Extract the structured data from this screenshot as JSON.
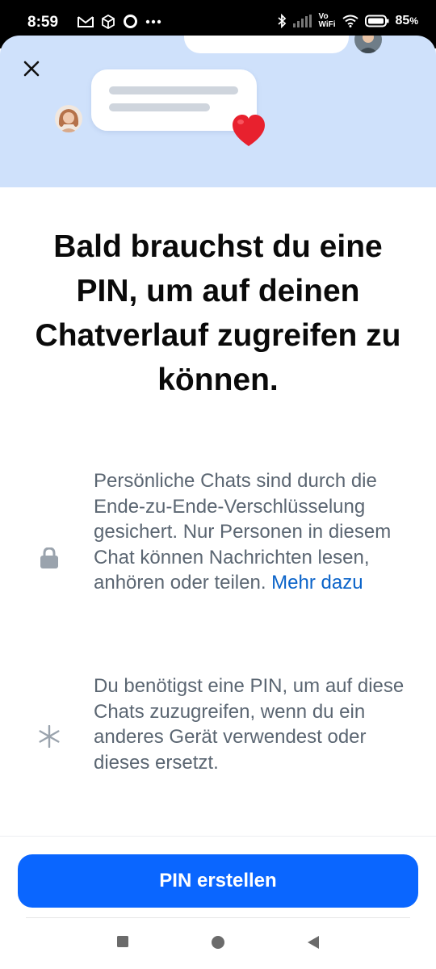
{
  "status_bar": {
    "time": "8:59",
    "left_icons": [
      "gmail-icon",
      "cube-icon",
      "circle-icon",
      "more-dots-icon"
    ],
    "right_icons": [
      "bluetooth-icon",
      "signal-icon",
      "vowifi-icon",
      "wifi-icon",
      "battery-icon"
    ],
    "vowifi_top": "Vo",
    "vowifi_bottom": "WiFi",
    "battery_percent": "85",
    "battery_suffix": "%"
  },
  "hero": {
    "close_icon": "close-icon",
    "decoration_icons": [
      "avatar",
      "heart-icon"
    ]
  },
  "headline": "Bald brauchst du eine PIN, um auf deinen Chatverlauf zugreifen zu können.",
  "info": {
    "encryption": {
      "icon": "lock-icon",
      "text": "Persönliche Chats sind durch die Ende-zu-Ende-Verschlüsselung gesichert. Nur Personen in diesem Chat können Nachrichten lesen, anhören oder teilen. ",
      "link_label": "Mehr dazu"
    },
    "pin": {
      "icon": "asterisk-icon",
      "text": "Du benötigst eine PIN, um auf diese Chats zuzugreifen, wenn du ein anderes Gerät verwendest oder dieses ersetzt."
    }
  },
  "cta_label": "PIN erstellen",
  "nav_bar": {
    "buttons": [
      "recents-square-icon",
      "home-circle-icon",
      "back-triangle-icon"
    ]
  },
  "colors": {
    "primary": "#0a66ff",
    "link": "#0a63c9",
    "hero_bg": "#cfe1fb",
    "body_text": "#5b6672"
  }
}
